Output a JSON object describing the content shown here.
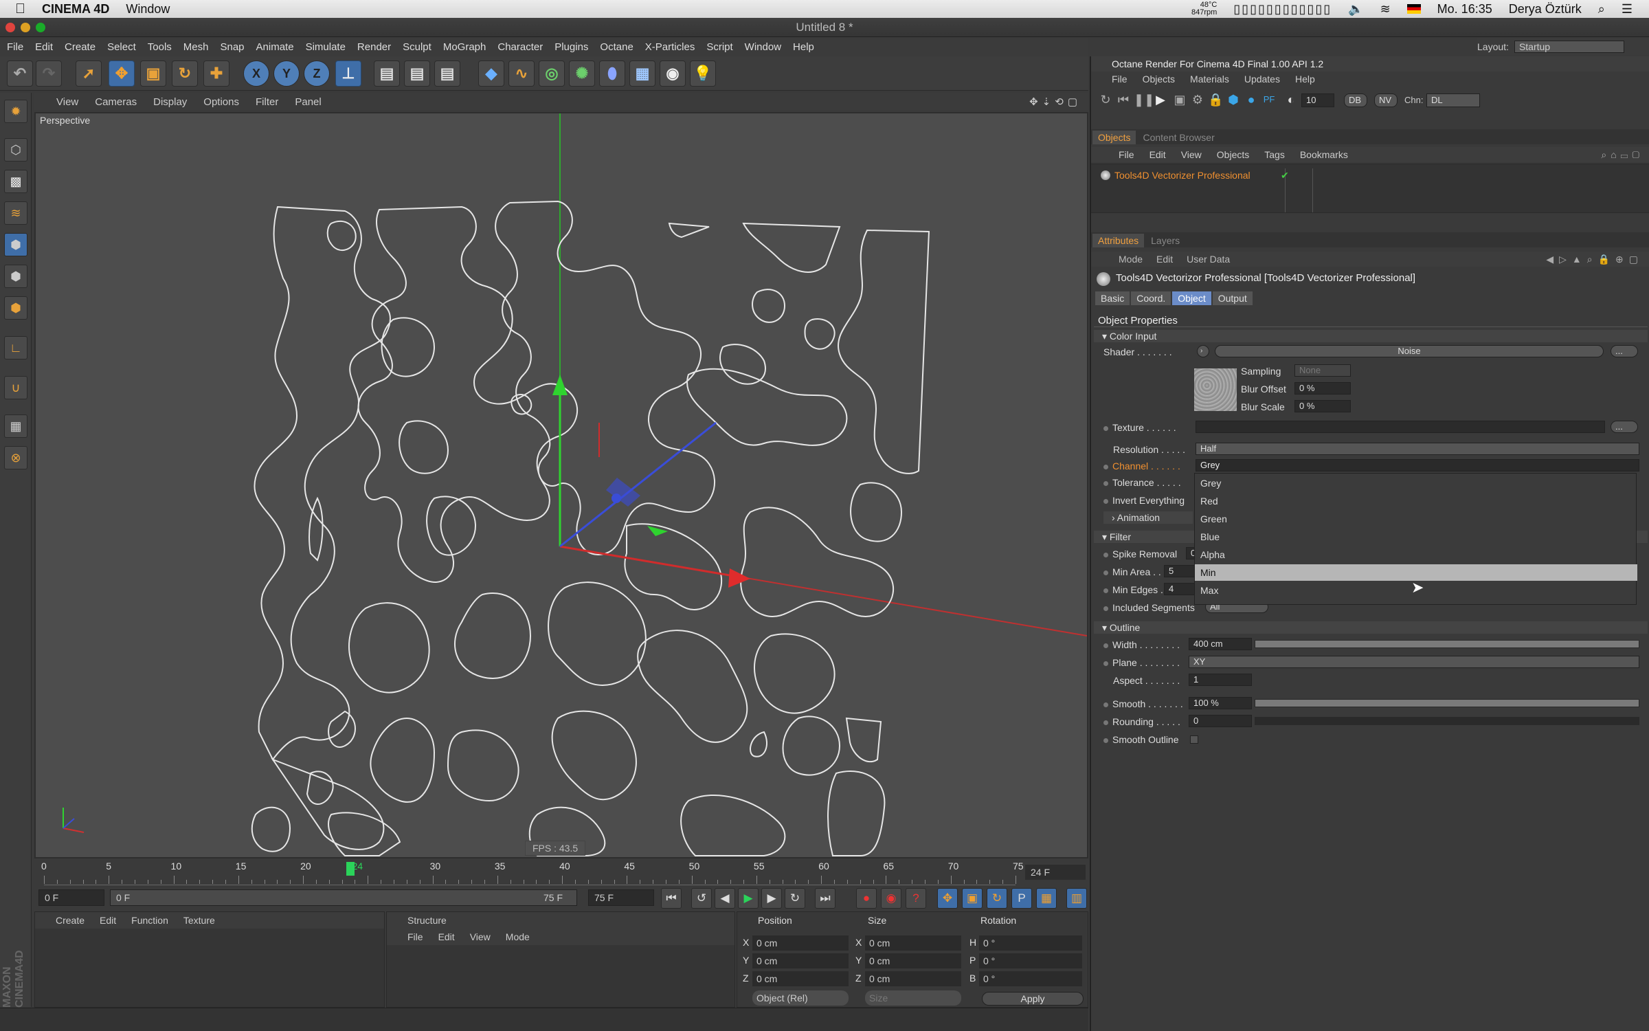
{
  "os_menubar": {
    "app": "CINEMA 4D",
    "window": "Window",
    "temp": "48°C",
    "rpm": "847rpm",
    "time": "Mo. 16:35",
    "user": "Derya Öztürk"
  },
  "window": {
    "title": "Untitled 8 *"
  },
  "main_menu": [
    "File",
    "Edit",
    "Create",
    "Select",
    "Tools",
    "Mesh",
    "Snap",
    "Animate",
    "Simulate",
    "Render",
    "Sculpt",
    "MoGraph",
    "Character",
    "Plugins",
    "Octane",
    "X-Particles",
    "Script",
    "Window",
    "Help"
  ],
  "layout": {
    "label": "Layout:",
    "value": "Startup"
  },
  "viewport_menu": [
    "View",
    "Cameras",
    "Display",
    "Options",
    "Filter",
    "Panel"
  ],
  "viewport": {
    "label": "Perspective",
    "fps": "FPS : 43.5"
  },
  "timeline": {
    "ticks": [
      "0",
      "5",
      "10",
      "15",
      "20",
      "24",
      "30",
      "35",
      "40",
      "45",
      "50",
      "55",
      "60",
      "65",
      "70",
      "75"
    ],
    "current": 24,
    "frame_display": "24 F"
  },
  "transport": {
    "start": "0 F",
    "range_start": "0 F",
    "range_end": "75 F",
    "end": "75 F"
  },
  "material_menu": [
    "Create",
    "Edit",
    "Function",
    "Texture"
  ],
  "structure": {
    "title": "Structure",
    "menu": [
      "File",
      "Edit",
      "View",
      "Mode"
    ]
  },
  "coords": {
    "headers": [
      "Position",
      "Size",
      "Rotation"
    ],
    "rows": [
      {
        "axis": "X",
        "pos": "0 cm",
        "saxis": "X",
        "size": "0 cm",
        "raxis": "H",
        "rot": "0 °"
      },
      {
        "axis": "Y",
        "pos": "0 cm",
        "saxis": "Y",
        "size": "0 cm",
        "raxis": "P",
        "rot": "0 °"
      },
      {
        "axis": "Z",
        "pos": "0 cm",
        "saxis": "Z",
        "size": "0 cm",
        "raxis": "B",
        "rot": "0 °"
      }
    ],
    "mode": "Object (Rel)",
    "size_mode": "Size",
    "apply": "Apply"
  },
  "octane": {
    "title": "Octane Render For Cinema 4D Final 1.00   API 1.2",
    "menu": [
      "File",
      "Objects",
      "Materials",
      "Updates",
      "Help"
    ],
    "samples": "10",
    "db": "DB",
    "nv": "NV",
    "chn_label": "Chn:",
    "chn": "DL",
    "pf": "PF"
  },
  "objects_tabs": [
    "Objects",
    "Content Browser"
  ],
  "objects_menu": [
    "File",
    "Edit",
    "View",
    "Objects",
    "Tags",
    "Bookmarks"
  ],
  "object_item": "Tools4D Vectorizer Professional",
  "attr_tabs": [
    "Attributes",
    "Layers"
  ],
  "attr_menu": [
    "Mode",
    "Edit",
    "User Data"
  ],
  "attr_title": "Tools4D Vectorizor Professional [Tools4D Vectorizer Professional]",
  "attr_subtabs": [
    "Basic",
    "Coord.",
    "Object",
    "Output"
  ],
  "props": {
    "section": "Object Properties",
    "color_input": "Color Input",
    "shader_label": "Shader . . . . . . .",
    "shader_value": "Noise",
    "sampling_label": "Sampling",
    "sampling_value": "None",
    "blur_offset_label": "Blur Offset",
    "blur_offset_value": "0 %",
    "blur_scale_label": "Blur Scale",
    "blur_scale_value": "0 %",
    "texture_label": "Texture . . . . . .",
    "resolution_label": "Resolution . . . . .",
    "resolution_value": "Half",
    "channel_label": "Channel . . . . . .",
    "channel_value": "Grey",
    "tolerance_label": "Tolerance . . . . .",
    "invert_label": "Invert Everything",
    "animation": "Animation",
    "filter": "Filter",
    "spike_label": "Spike Removal",
    "spike_value": "0",
    "minarea_label": "Min Area . . . . .",
    "minarea_value": "5",
    "minedges_label": "Min Edges . . . .",
    "minedges_value": "4",
    "segments_label": "Included Segments",
    "segments_value": "All",
    "outline": "Outline",
    "width_label": "Width . . . . . . . .",
    "width_value": "400 cm",
    "plane_label": "Plane . . . . . . . .",
    "plane_value": "XY",
    "aspect_label": "Aspect . . . . . . .",
    "aspect_value": "1",
    "smooth_label": "Smooth . . . . . . .",
    "smooth_value": "100 %",
    "rounding_label": "Rounding . . . . .",
    "rounding_value": "0",
    "smooth_outline_label": "Smooth Outline"
  },
  "channel_options": [
    "Grey",
    "Red",
    "Green",
    "Blue",
    "Alpha",
    "Min",
    "Max"
  ],
  "channel_highlight": "Min",
  "colors": {
    "accent": "#f09030",
    "selected_tab": "#6b8cc8",
    "playhead": "#2bd35a"
  }
}
